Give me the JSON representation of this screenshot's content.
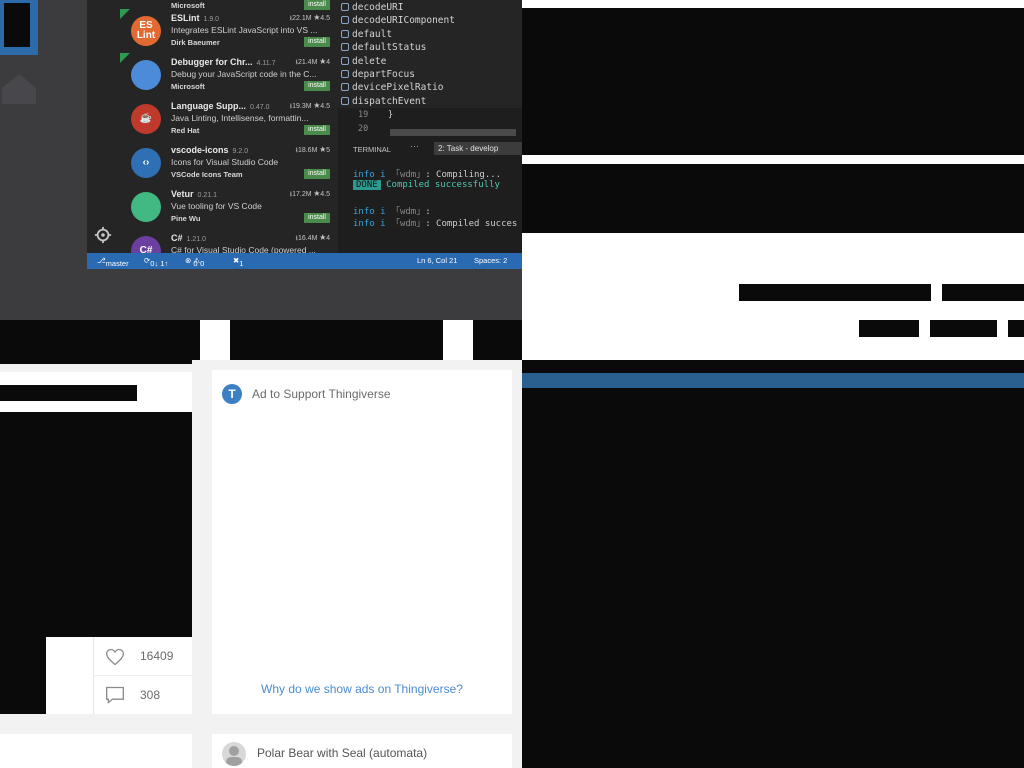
{
  "vscode": {
    "extensions": [
      {
        "name": "ESLint",
        "version": "1.9.0",
        "downloads": "22.1M",
        "rating": "4.5",
        "description": "Integrates ESLint JavaScript into VS ...",
        "publisher": "Dirk Baeumer",
        "install": "install",
        "icon_text": "ES Lint",
        "color": "#e26a32"
      },
      {
        "name": "Debugger for Chr...",
        "version": "4.11.7",
        "downloads": "21.4M",
        "rating": "4",
        "description": "Debug your JavaScript code in the C...",
        "publisher": "Microsoft",
        "install": "install",
        "icon_text": "",
        "color": "#4b8bd8"
      },
      {
        "name": "Language Supp...",
        "version": "0.47.0",
        "downloads": "19.3M",
        "rating": "4.5",
        "description": "Java Linting, Intellisense, formattin...",
        "publisher": "Red Hat",
        "install": "install",
        "icon_text": "☕",
        "color": "#c03a2b"
      },
      {
        "name": "vscode-icons",
        "version": "9.2.0",
        "downloads": "18.6M",
        "rating": "5",
        "description": "Icons for Visual Studio Code",
        "publisher": "VSCode Icons Team",
        "install": "install",
        "icon_text": "‹›",
        "color": "#2f6fb3"
      },
      {
        "name": "Vetur",
        "version": "0.21.1",
        "downloads": "17.2M",
        "rating": "4.5",
        "description": "Vue tooling for VS Code",
        "publisher": "Pine Wu",
        "install": "install",
        "icon_text": "",
        "color": "#42b883"
      },
      {
        "name": "C#",
        "version": "1.21.0",
        "downloads": "16.4M",
        "rating": "4",
        "description": "C# for Visual Studio Code (powered ...",
        "publisher": "",
        "install": "",
        "icon_text": "C#",
        "color": "#6a3fa0"
      }
    ],
    "top_partial_publisher": "Microsoft",
    "top_partial_install": "install",
    "suggestions": [
      "decodeURI",
      "decodeURIComponent",
      "default",
      "defaultStatus",
      "delete",
      "departFocus",
      "devicePixelRatio",
      "dispatchEvent"
    ],
    "code_lines": [
      {
        "num": "19",
        "text": "}"
      },
      {
        "num": "20",
        "text": ""
      }
    ],
    "terminal": {
      "title": "TERMINAL",
      "dots": "···",
      "task": "2: Task - develop",
      "lines": [
        {
          "info": "info",
          "mark": "i",
          "src": "「wdm」",
          "text": ": Compiling..."
        },
        {
          "done": "DONE",
          "text": "Compiled successfully"
        },
        {
          "info": "info",
          "mark": "i",
          "src": "「wdm」",
          "text": ":"
        },
        {
          "info": "info",
          "mark": "i",
          "src": "「wdm」",
          "text": ": Compiled succes"
        }
      ]
    },
    "status": {
      "branch": "master",
      "sync": "0↓ 1↑",
      "errors": "0",
      "warnings": "0",
      "ext": "1",
      "position": "Ln 6, Col 21",
      "spaces": "Spaces: 2"
    }
  },
  "ad": {
    "logo_letter": "T",
    "label": "Ad to Support Thingiverse",
    "why": "Why do we show ads on Thingiverse?"
  },
  "thing": {
    "likes": "16409",
    "comments": "308"
  },
  "next_thing": {
    "title": "Polar Bear with Seal (automata)"
  },
  "colors": {
    "status_bar": "#2a6ab3",
    "accent_link": "#4a8ccf",
    "right_band": "#2a6090"
  }
}
